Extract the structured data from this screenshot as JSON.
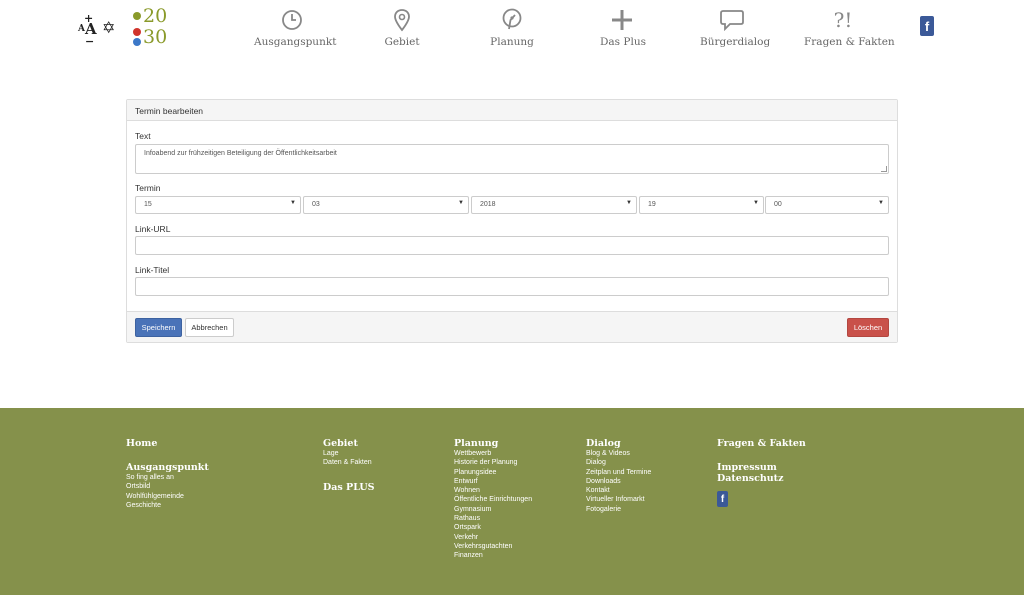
{
  "header": {
    "font_control": {
      "plus": "+",
      "aa_small": "A",
      "aa_big": "A",
      "minus": "−"
    },
    "star_glyph": "✡",
    "logo": {
      "line1": "20",
      "line2": "30"
    },
    "nav": [
      {
        "label": "Ausgangspunkt",
        "icon": "clock-icon"
      },
      {
        "label": "Gebiet",
        "icon": "map-pin-icon"
      },
      {
        "label": "Planung",
        "icon": "compass-pin-icon"
      },
      {
        "label": "Das Plus",
        "icon": "plus-icon"
      },
      {
        "label": "Bürgerdialog",
        "icon": "speech-bubble-icon"
      },
      {
        "label": "Fragen & Fakten",
        "icon": "question-exclamation-icon",
        "glyph": "?!"
      }
    ],
    "facebook_glyph": "f"
  },
  "form": {
    "heading": "Termin bearbeiten",
    "text_label": "Text",
    "text_value": "Infoabend zur frühzeitigen Beteiligung der Öffentlichkeitsarbeit",
    "termin_label": "Termin",
    "termin": {
      "day": "15",
      "month": "03",
      "year": "2018",
      "hour": "19",
      "minute": "00"
    },
    "caret_glyph": "▼",
    "link_url_label": "Link-URL",
    "link_url_value": "",
    "link_title_label": "Link-Titel",
    "link_title_value": "",
    "save_label": "Speichern",
    "cancel_label": "Abbrechen",
    "delete_label": "Löschen"
  },
  "footer": {
    "home": "Home",
    "ausgangspunkt": {
      "title": "Ausgangspunkt",
      "links": [
        "So fing alles an",
        "Ortsbild",
        "Wohlfühlgemeinde",
        "Geschichte"
      ]
    },
    "gebiet": {
      "title": "Gebiet",
      "links": [
        "Lage",
        "Daten & Fakten"
      ]
    },
    "das_plus": "Das PLUS",
    "planung": {
      "title": "Planung",
      "links": [
        "Wettbewerb",
        "Historie der Planung",
        "Planungsidee",
        "Entwurf",
        "Wohnen",
        "Öffentliche Einrichtungen",
        "Gymnasium",
        "Rathaus",
        "Ortspark",
        "Verkehr",
        "Verkehrsgutachten",
        "Finanzen"
      ]
    },
    "dialog": {
      "title": "Dialog",
      "links": [
        "Blog & Videos",
        "Dialog",
        "Zeitplan und Termine",
        "Downloads",
        "Kontakt",
        "Virtueller Infomarkt",
        "Fotogalerie"
      ]
    },
    "fragen": "Fragen & Fakten",
    "impressum": "Impressum",
    "datenschutz": "Datenschutz",
    "facebook_glyph": "f"
  },
  "colors": {
    "footer_bg": "#85914b",
    "primary": "#4a73b8",
    "danger": "#c9514a",
    "logo_green": "#8a9a2a"
  }
}
